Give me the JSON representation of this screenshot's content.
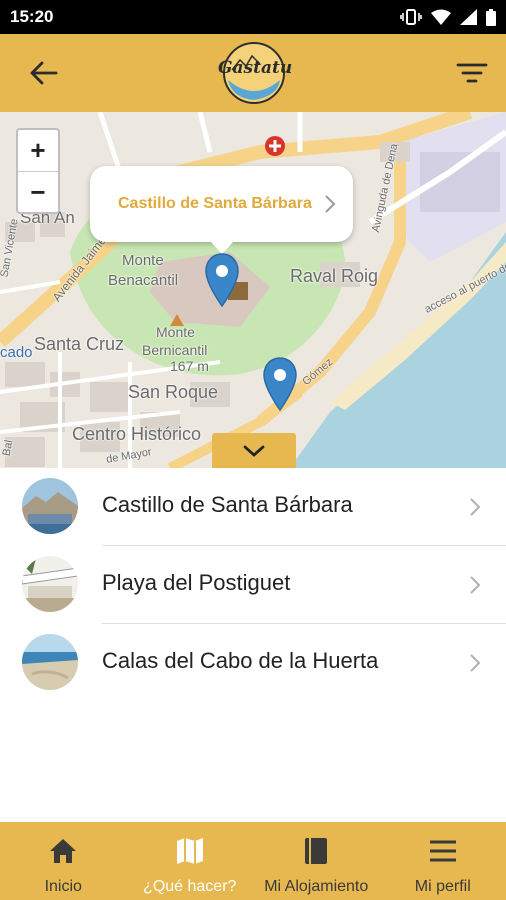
{
  "status_bar": {
    "time": "15:20"
  },
  "header": {
    "logo_text": "Gastatu",
    "back_icon": "arrow-left-icon",
    "filter_icon": "filter-icon"
  },
  "map": {
    "zoom_in": "+",
    "zoom_out": "−",
    "popup_title": "Castillo de Santa Bárbara",
    "labels": {
      "san_an": "San An",
      "monte": "Monte",
      "benacantil": "Benacantil",
      "raval_roig": "Raval Roig",
      "santa_cruz": "Santa Cruz",
      "monte2": "Monte",
      "bernicantil": "Bernicantil",
      "height": "167 m",
      "san_roque": "San Roque",
      "centro": "Centro Histórico",
      "cado": "cado",
      "avenida_jaime": "Avenida Jaime",
      "avenida_dena": "Avinguda de Dena",
      "acceso": "acceso al puerto de",
      "gomez": "Gómez",
      "mayor": "de Mayor",
      "vicente": "San Vicente",
      "bal": "Bal"
    }
  },
  "places": [
    {
      "label": "Castillo de Santa Bárbara"
    },
    {
      "label": "Playa del Postiguet"
    },
    {
      "label": "Calas del Cabo de la Huerta"
    }
  ],
  "nav": [
    {
      "label": "Inicio",
      "icon": "home-icon"
    },
    {
      "label": "¿Qué hacer?",
      "icon": "map-icon"
    },
    {
      "label": "Mi Alojamiento",
      "icon": "book-icon"
    },
    {
      "label": "Mi perfil",
      "icon": "menu-icon"
    }
  ],
  "colors": {
    "brand": "#e6b84f",
    "accent_text": "#e0a93c",
    "pin": "#3b86c8",
    "sea": "#aad3df"
  }
}
